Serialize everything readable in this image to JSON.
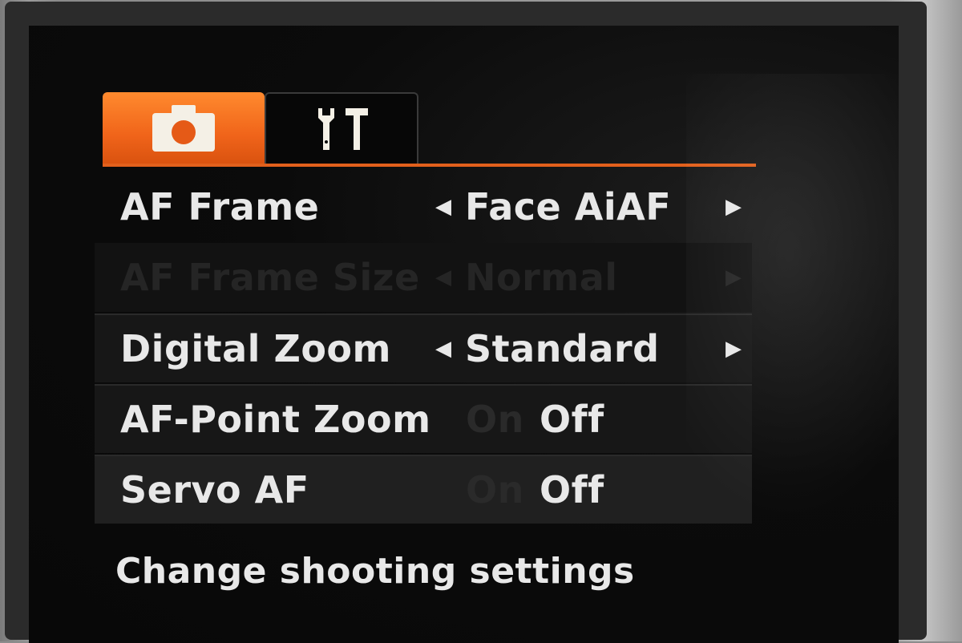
{
  "tabs": [
    {
      "name": "camera-tab",
      "icon": "camera-icon",
      "active": true,
      "color": "#f0641a"
    },
    {
      "name": "tools-tab",
      "icon": "wrench-hammer-icon",
      "active": false
    }
  ],
  "menu": {
    "items": [
      {
        "label": "AF Frame",
        "value": "Face AiAF",
        "left_arrow": "◀",
        "right_arrow": "▶"
      },
      {
        "label": "AF Frame Size",
        "value": "Normal",
        "left_arrow": "◀",
        "right_arrow": "▶",
        "disabled": true
      },
      {
        "label": "Digital Zoom",
        "value": "Standard",
        "left_arrow": "◀",
        "right_arrow": "▶"
      },
      {
        "label": "AF-Point Zoom",
        "on_label": "On",
        "off_label": "Off",
        "selected": "Off"
      },
      {
        "label": "Servo AF",
        "on_label": "On",
        "off_label": "Off",
        "selected": "Off"
      }
    ]
  },
  "help_text": "Change shooting settings",
  "colors": {
    "accent": "#f0641a",
    "text": "#e8e8e8",
    "background": "#0b0b0b"
  }
}
